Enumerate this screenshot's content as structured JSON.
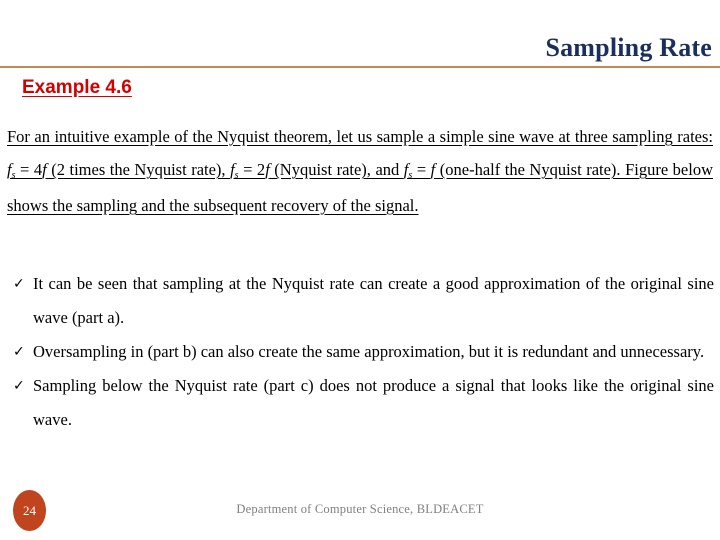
{
  "slide": {
    "title": "Sampling Rate",
    "title_color": "#1b2f5e",
    "rule_color": "#c08a52",
    "example_heading": "Example 4.6",
    "example_heading_color": "#d30000"
  },
  "paragraph": {
    "part1": "For an intuitive example of the Nyquist theorem, let us sample a simple sine wave at three sampling rates: ",
    "f1_base": "f",
    "f1_sub": "s",
    "part2": " = 4",
    "f1_mult": "f",
    "part3": " (2 times the Nyquist rate), ",
    "f2_base": "f",
    "f2_sub": "s",
    "part4": " = 2",
    "f2_mult": "f",
    "part5": " (Nyquist rate), and ",
    "f3_base": "f",
    "f3_sub": "s",
    "part6": " = ",
    "f3_mult": "f",
    "part7": " (one-half the Nyquist rate). Figure below shows the sampling and the subsequent recovery of the signal."
  },
  "bullets": {
    "marker": "✓",
    "items": [
      "It can be seen that sampling at the Nyquist rate can create a good approximation of the original sine wave (part a).",
      "Oversampling in (part b) can also create the same approximation, but it is redundant and unnecessary.",
      "Sampling below the Nyquist rate (part c) does not produce a signal that looks like the original sine wave."
    ]
  },
  "footer": {
    "page_number": "24",
    "badge_color": "#c0441e",
    "credit": "Department of Computer Science, BLDEACET",
    "credit_color": "#808080"
  }
}
